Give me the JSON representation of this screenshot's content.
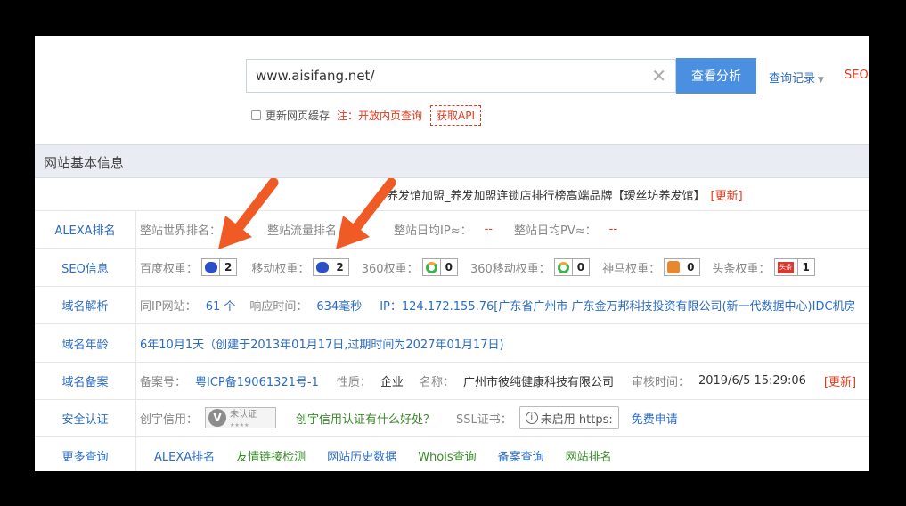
{
  "search": {
    "value": "www.aisifang.net/",
    "button": "查看分析",
    "history": "查询记录",
    "seo": "SEO",
    "refresh_cache": "更新网页缓存",
    "note": "注：开放内页查询",
    "api": "获取API"
  },
  "section_title": "网站基本信息",
  "site_title": "养发馆加盟_养发加盟连锁店排行榜高端品牌【瑷丝坊养发馆】",
  "update_label": "[更新]",
  "alexa": {
    "label": "ALEXA排名",
    "world_rank": "整站世界排名：",
    "traffic_rank": "整站流量排名",
    "daily_ip": "整站日均IP≈：",
    "daily_ip_value": "--",
    "daily_pv": "整站日均PV≈：",
    "daily_pv_value": "--"
  },
  "seo": {
    "label": "SEO信息",
    "baidu": "百度权重：",
    "baidu_value": "2",
    "mobile": "移动权重：",
    "mobile_value": "2",
    "q360": "360权重：",
    "q360_value": "0",
    "q360m": "360移动权重：",
    "q360m_value": "0",
    "shenma": "神马权重：",
    "shenma_value": "0",
    "toutiao": "头条权重：",
    "toutiao_value": "1",
    "toutiao_icon_text": "头条"
  },
  "dns": {
    "label": "域名解析",
    "same_ip": "同IP网站：",
    "same_ip_value": "61 个",
    "response": "响应时间：",
    "response_value": "634毫秒",
    "ip": "IP：124.172.155.76[广东省广州市 广东金万邦科技投资有限公司(新一代数据中心)IDC机房"
  },
  "age": {
    "label": "域名年龄",
    "value": "6年10月1天（创建于2013年01月17日,过期时间为2027年01月17日)"
  },
  "icp": {
    "label": "域名备案",
    "no": "备案号：",
    "no_value": "粤ICP备19061321号-1",
    "nature": "性质：",
    "nature_value": "企业",
    "name": "名称：",
    "name_value": "广州市彼纯健康科技有限公司",
    "audit": "审核时间：",
    "audit_value": "2019/6/5 15:29:06",
    "update": "[更新]"
  },
  "security": {
    "label": "安全认证",
    "credit": "创宇信用：",
    "credit_badge": "未认证",
    "credit_badge_stars": "★★★★",
    "credit_link": "创宇信用认证有什么好处？",
    "ssl": "SSL证书：",
    "ssl_badge": "未启用 https:",
    "ssl_apply": "免费申请"
  },
  "more": {
    "label": "更多查询",
    "links": [
      "ALEXA排名",
      "友情链接检测",
      "网站历史数据",
      "Whois查询",
      "备案查询",
      "网站排名"
    ]
  },
  "colors": {
    "accent": "#4a8fe0",
    "link": "#2b6cc4",
    "warn": "#e4391b",
    "arrow": "#f05a24"
  }
}
